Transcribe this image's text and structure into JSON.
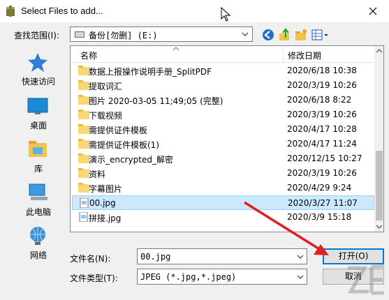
{
  "window": {
    "title": "Select Files to add...",
    "app_icon": "archive-app-icon",
    "close_icon": "close-icon"
  },
  "lookin": {
    "label": "查找范围(I):",
    "value": "备份[勿删] (E:)"
  },
  "places": [
    {
      "label": "快速访问",
      "icon": "star-icon"
    },
    {
      "label": "桌面",
      "icon": "desktop-icon"
    },
    {
      "label": "库",
      "icon": "library-icon"
    },
    {
      "label": "此电脑",
      "icon": "computer-icon"
    },
    {
      "label": "网络",
      "icon": "network-icon"
    }
  ],
  "columns": {
    "name": "名称",
    "date": "修改日期"
  },
  "files": [
    {
      "name": "数据上报操作说明手册_SplitPDF",
      "date": "2020/6/18 10:38",
      "type": "folder"
    },
    {
      "name": "提取词汇",
      "date": "2020/3/19 10:26",
      "type": "folder"
    },
    {
      "name": "图片 2020-03-05 11;49;05 (完整)",
      "date": "2020/6/18 8:22",
      "type": "folder"
    },
    {
      "name": "下载视频",
      "date": "2020/3/19 10:26",
      "type": "folder"
    },
    {
      "name": "需提供证件模板",
      "date": "2020/4/17 10:28",
      "type": "folder"
    },
    {
      "name": "需提供证件模板(1)",
      "date": "2020/4/17 11:24",
      "type": "folder"
    },
    {
      "name": "演示_encrypted_解密",
      "date": "2020/12/15 10:27",
      "type": "folder"
    },
    {
      "name": "资料",
      "date": "2020/3/19 10:26",
      "type": "folder"
    },
    {
      "name": "字幕图片",
      "date": "2020/4/29 9:24",
      "type": "folder"
    },
    {
      "name": "00.jpg",
      "date": "2020/3/27 11:07",
      "type": "image",
      "selected": true
    },
    {
      "name": "拼接.jpg",
      "date": "2020/3/9 15:18",
      "type": "image"
    }
  ],
  "filename": {
    "label": "文件名(N):",
    "value": "00.jpg"
  },
  "filetype": {
    "label": "文件类型(T):",
    "value": "JPEG (*.jpg,*.jpeg)"
  },
  "buttons": {
    "open": "打开(O)",
    "cancel": "取消"
  },
  "colors": {
    "selection": "#cce8ff",
    "accent": "#0078d7",
    "folder": "#f8d775",
    "annotation_arrow": "#e02020"
  }
}
